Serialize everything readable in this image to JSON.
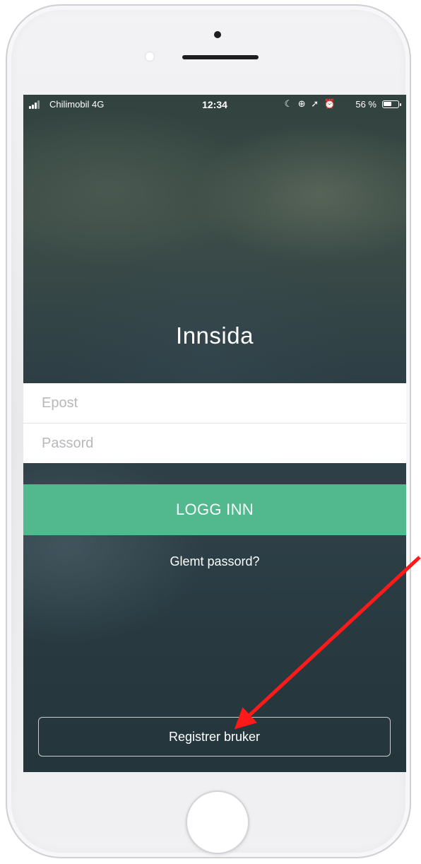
{
  "status_bar": {
    "carrier": "Chilimobil  4G",
    "time": "12:34",
    "status_icons": "☾ ⊕ ➚ ⏰",
    "battery_percent": "56 %",
    "battery_level": 0.56
  },
  "app": {
    "title": "Innsida"
  },
  "login": {
    "email_placeholder": "Epost",
    "password_placeholder": "Passord",
    "login_button": "LOGG INN",
    "forgot_password": "Glemt passord?",
    "register_button": "Registrer bruker"
  },
  "colors": {
    "accent_green": "#52b98f",
    "annotation_red": "#ff1a1a"
  },
  "icons": {
    "signal": "signal-bars-icon",
    "battery": "battery-icon",
    "annotation": "red-arrow-icon"
  }
}
